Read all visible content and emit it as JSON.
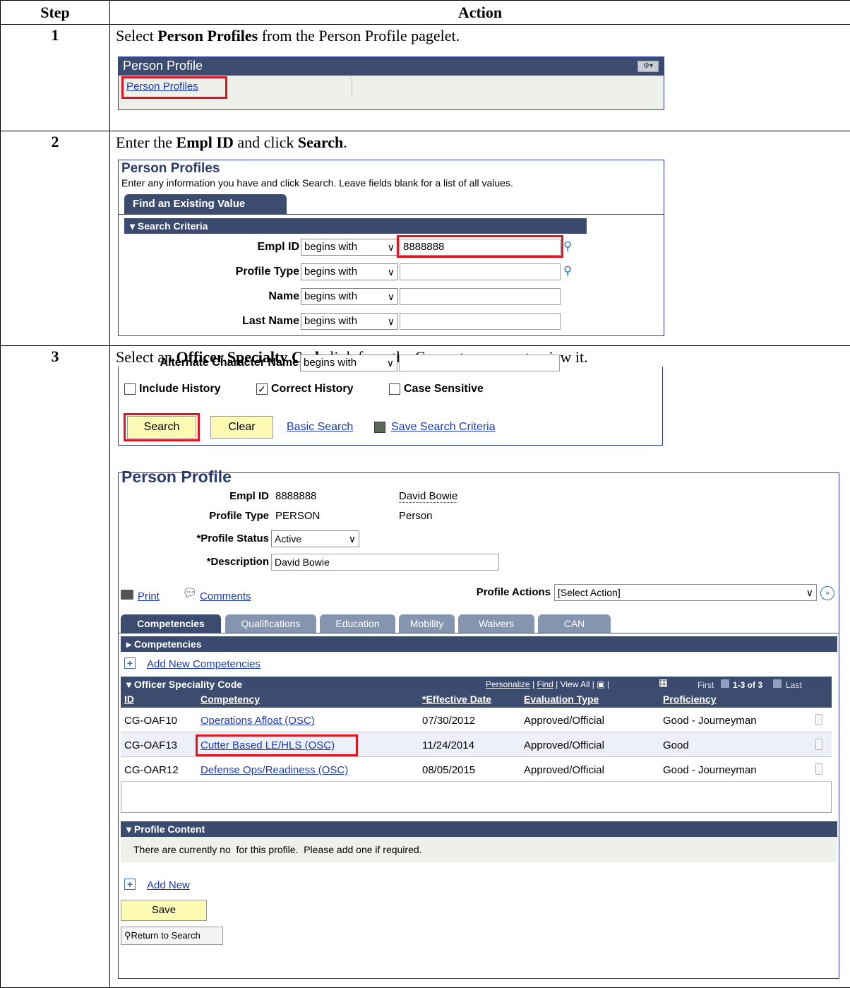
{
  "table": {
    "col_step": "Step",
    "col_action": "Action"
  },
  "steps": [
    {
      "number": "1",
      "instruction": {
        "pre": "Select ",
        "bold1": "Person Profiles",
        "post": " from the Person Profile pagelet."
      },
      "pagelet": {
        "title": "Person Profile",
        "link": "Person Profiles",
        "menu_icon": "gear-chevron-icon"
      }
    },
    {
      "number": "2",
      "instruction": {
        "pre": "Enter the ",
        "bold1": "Empl ID",
        "mid": " and click ",
        "bold2": "Search",
        "post": "."
      },
      "search_page": {
        "title": "Person Profiles",
        "subtitle": "Enter any information you have and click Search. Leave fields blank for a list of all values.",
        "tab": "Find an Existing Value",
        "section": "Search Criteria",
        "fields": [
          {
            "label": "Empl ID",
            "operator": "begins with",
            "value": "8888888",
            "lookup": true
          },
          {
            "label": "Profile Type",
            "operator": "begins with",
            "value": "",
            "lookup": true
          },
          {
            "label": "Name",
            "operator": "begins with",
            "value": "",
            "lookup": false
          },
          {
            "label": "Last Name",
            "operator": "begins with",
            "value": "",
            "lookup": false
          },
          {
            "label": "Alternate Character Name",
            "operator": "begins with",
            "value": "",
            "lookup": false
          }
        ],
        "checkboxes": [
          {
            "label": "Include History",
            "checked": false
          },
          {
            "label": "Correct History",
            "checked": true
          },
          {
            "label": "Case Sensitive",
            "checked": false
          }
        ],
        "buttons": {
          "search": "Search",
          "clear": "Clear"
        },
        "links": {
          "basic": "Basic Search",
          "save": "Save Search Criteria"
        }
      }
    },
    {
      "number": "3",
      "instruction": {
        "pre": "Select an ",
        "bold1": "Officer Specialty Code",
        "post": " link from the Competency row to view it."
      },
      "profile_page": {
        "title": "Person Profile",
        "empl_id_label": "Empl ID",
        "empl_id": "8888888",
        "name": "David Bowie",
        "profile_type_label": "Profile Type",
        "profile_type": "PERSON",
        "profile_type_desc": "Person",
        "status_label": "*Profile Status",
        "status": "Active",
        "description_label": "*Description",
        "description": "David Bowie",
        "print": "Print",
        "comments": "Comments",
        "actions_label": "Profile Actions",
        "actions_value": "[Select Action]",
        "tabs": [
          "Competencies",
          "Qualifications",
          "Education",
          "Mobility",
          "Waivers",
          "CAN"
        ],
        "competencies_bar": "Competencies",
        "add_competencies": "Add New Competencies",
        "grid": {
          "title": "Officer Speciality Code",
          "nav": {
            "personalize": "Personalize",
            "find": "Find",
            "view_all": "View All",
            "first": "First",
            "range": "1-3 of 3",
            "last": "Last"
          },
          "headers": [
            "ID",
            "Competency",
            "*Effective Date",
            "Evaluation Type",
            "Proficiency"
          ],
          "rows": [
            {
              "id": "CG-OAF10",
              "competency": "Operations Afloat (OSC)",
              "date": "07/30/2012",
              "eval": "Approved/Official",
              "prof": "Good - Journeyman"
            },
            {
              "id": "CG-OAF13",
              "competency": "Cutter Based LE/HLS (OSC)",
              "date": "11/24/2014",
              "eval": "Approved/Official",
              "prof": "Good"
            },
            {
              "id": "CG-OAR12",
              "competency": "Defense Ops/Readiness (OSC)",
              "date": "08/05/2015",
              "eval": "Approved/Official",
              "prof": "Good - Journeyman"
            }
          ]
        },
        "content_bar": "Profile Content",
        "content_msg": "There are currently no  for this profile.  Please add one if required.",
        "add_new": "Add New",
        "save": "Save",
        "return": "Return to Search"
      }
    }
  ]
}
